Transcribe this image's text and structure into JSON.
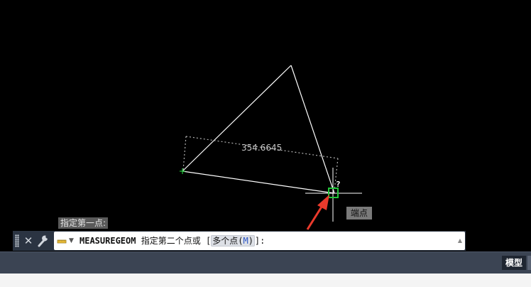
{
  "drawing": {
    "dimension_value": "354.6645",
    "snap_tooltip": "端点",
    "snap_question_mark": "?",
    "previous_prompt": "指定第一点:"
  },
  "command_line": {
    "command_name": "MEASUREGEOM",
    "prompt_text": "指定第二个点或",
    "bracket_open": "[",
    "option_label": "多个点",
    "option_paren_open": "(",
    "option_key": "M",
    "option_paren_close": ")",
    "bracket_close": "]:",
    "close_icon": "close-icon",
    "customize_icon": "wrench-icon",
    "recent_icon": "command-recent-icon"
  },
  "status_bar": {
    "model_tab_label": "模型"
  },
  "colors": {
    "canvas_background": "#000000",
    "geometry_line": "#ffffff",
    "dimension_dotted": "#b0b0b0",
    "snap_marker": "#22c53a",
    "annotation_arrow": "#ea3a2c"
  }
}
